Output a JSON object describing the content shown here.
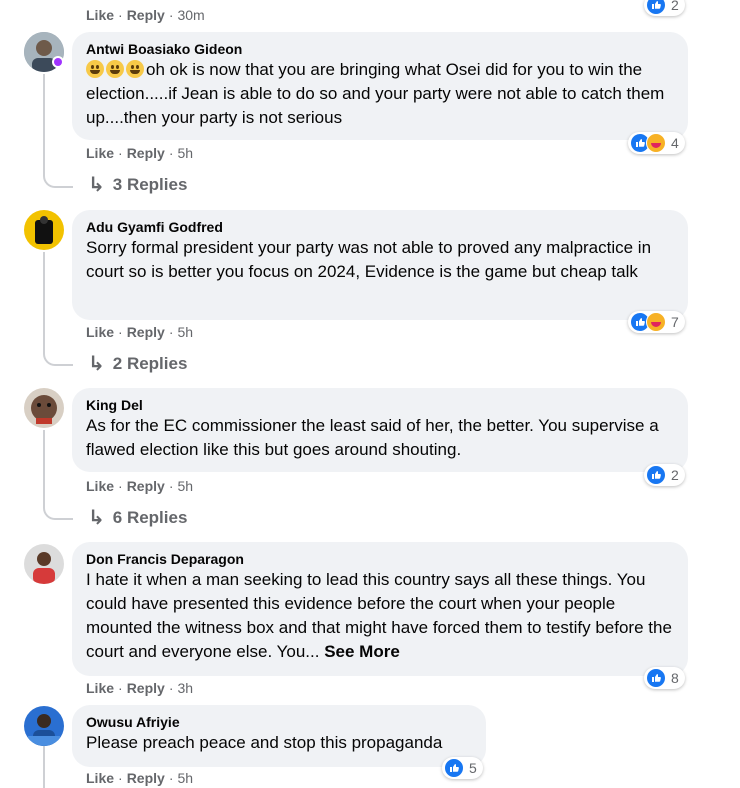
{
  "meta": {
    "like": "Like",
    "reply": "Reply"
  },
  "top": {
    "time": "30m",
    "reactions": "2"
  },
  "comments": [
    {
      "author": "Antwi Boasiako Gideon",
      "text": "oh ok is now that you are bringing what Osei did for you to win the election.....if Jean is able to do so and your party were not able to catch them up....then your party is not serious",
      "time": "5h",
      "reactions": "4",
      "replies": "3 Replies",
      "avatar_color": "#8a9aa8"
    },
    {
      "author": "Adu Gyamfi Godfred",
      "text": "Sorry formal president your party was not able to proved any malpractice in court so is better you focus on 2024, Evidence is the game but cheap talk",
      "time": "5h",
      "reactions": "7",
      "replies": "2 Replies",
      "avatar_color": "#f2c200"
    },
    {
      "author": "King Del",
      "text": "As for the EC commissioner the least said of her, the better. You supervise a flawed election like this but goes around shouting.",
      "time": "5h",
      "reactions": "2",
      "replies": "6 Replies",
      "avatar_color": "#6b4b3a"
    },
    {
      "author": "Don Francis Deparagon",
      "text": "I hate it when a man seeking to lead this country says all these things. You could have presented this evidence before the court when your people mounted the witness box and that might have forced them to testify before the court and everyone else. You...",
      "see_more": "See More",
      "time": "3h",
      "reactions": "8",
      "avatar_color": "#c9c9c9"
    },
    {
      "author": "Owusu Afriyie",
      "text": "Please preach peace and stop this propaganda",
      "time": "5h",
      "reactions": "5",
      "avatar_color": "#2a6fd1"
    }
  ]
}
